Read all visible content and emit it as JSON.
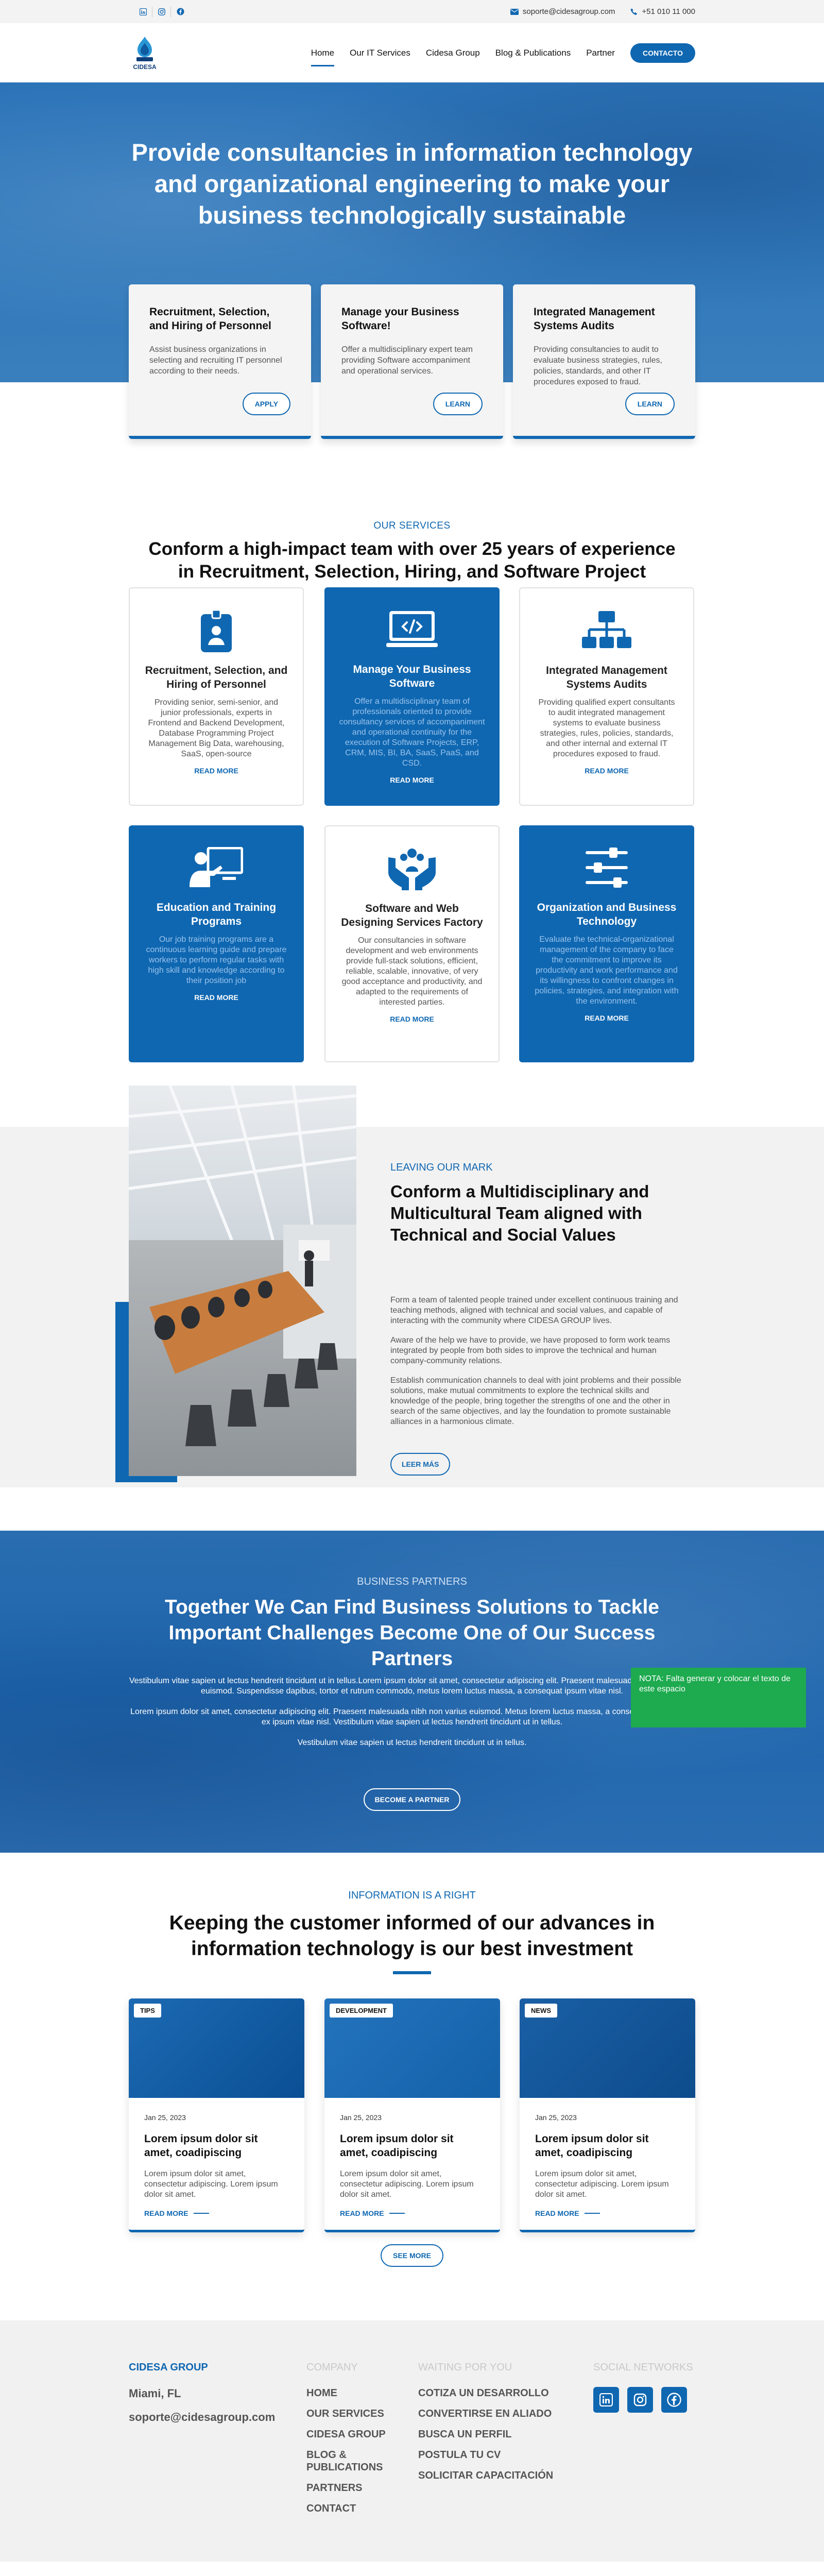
{
  "topbar": {
    "email": "soporte@cidesagroup.com",
    "phone": "+51 010 11 000"
  },
  "header": {
    "logo_text": "CIDESA",
    "nav": [
      "Home",
      "Our IT Services",
      "Cidesa Group",
      "Blog & Publications",
      "Partner"
    ],
    "contact_label": "CONTACTO"
  },
  "hero": {
    "title": "Provide consultancies in information technology and organizational engineering to make your business technologically sustainable",
    "cards": [
      {
        "title": "Recruitment, Selection, and Hiring of Personnel",
        "text": "Assist business organizations in selecting and recruiting IT personnel according to their needs.",
        "button": "APPLY"
      },
      {
        "title": "Manage your Business Software!",
        "text": "Offer a multidisciplinary expert team providing Software accompaniment and operational services.",
        "button": "LEARN"
      },
      {
        "title": "Integrated Management Systems Audits",
        "text": "Providing consultancies to audit to evaluate business strategies, rules, policies, standards, and other IT procedures exposed to fraud.",
        "button": "LEARN"
      }
    ]
  },
  "services": {
    "kicker": "OUR SERVICES",
    "title": "Conform a high-impact team with over 25 years of experience in Recruitment, Selection, Hiring, and Software Project Management",
    "cards": [
      {
        "icon": "id-badge-icon",
        "title": "Recruitment, Selection, and Hiring of Personnel",
        "text": "Providing senior, semi-senior, and junior professionals, experts in Frontend and Backend Development, Database Programming Project Management Big Data, warehousing, SaaS, open-source",
        "link": "READ MORE"
      },
      {
        "icon": "code-monitor-icon",
        "title": "Manage Your Business Software",
        "text": "Offer a multidisciplinary team of professionals oriented to provide consultancy services of accompaniment and operational continuity for the execution of Software Projects, ERP, CRM, MIS, BI, BA, SaaS, PaaS, and CSD.",
        "link": "READ MORE"
      },
      {
        "icon": "sitemap-icon",
        "title": "Integrated Management Systems Audits",
        "text": "Providing qualified expert consultants to audit integrated management systems to evaluate business strategies, rules, policies, standards, and other internal and external IT procedures exposed to fraud.",
        "link": "READ MORE"
      },
      {
        "icon": "teacher-icon",
        "title": "Education and Training Programs",
        "text": "Our job training programs are a continuous learning guide and prepare workers to perform regular tasks with high skill and knowledge according to their position job",
        "link": "READ MORE"
      },
      {
        "icon": "hands-people-icon",
        "title": "Software and Web Designing Services Factory",
        "text": "Our consultancies in software development and web environments provide full-stack solutions, efficient, reliable, scalable, innovative, of very good acceptance and productivity, and adapted to the requirements of interested parties.",
        "link": "READ MORE"
      },
      {
        "icon": "sliders-icon",
        "title": "Organization and Business Technology",
        "text": "Evaluate the technical-organizational management of the company to face the commitment to improve its productivity and work performance and its willingness to confront changes in policies, strategies, and integration with the environment.",
        "link": "READ MORE"
      }
    ]
  },
  "mark": {
    "kicker": "LEAVING OUR MARK",
    "title": "Conform a Multidisciplinary and Multicultural Team aligned with Technical and Social Values",
    "paragraphs": [
      "Form a team of talented people trained under excellent continuous training and teaching methods, aligned with technical and social values, and capable of interacting with the community where CIDESA GROUP lives.",
      "Aware of the help we have to provide, we have proposed to form work teams integrated by people from both sides to improve the technical and human company-community relations.",
      "Establish communication channels to deal with joint problems and their possible solutions, make mutual commitments to explore the technical skills and knowledge of the people, bring together the strengths of one and the other in search of the same objectives, and lay the foundation to promote sustainable alliances in a harmonious climate."
    ],
    "button": "LEER MÁS"
  },
  "partners": {
    "kicker": "BUSINESS PARTNERS",
    "title": "Together We Can Find Business Solutions to Tackle Important Challenges Become One of Our Success Partners",
    "paragraphs": [
      "Vestibulum vitae sapien ut lectus hendrerit tincidunt ut in tellus.Lorem ipsum dolor sit amet, consectetur adipiscing elit. Praesent malesuada nibh non varius euismod. Suspendisse dapibus, tortor et rutrum commodo, metus lorem luctus massa, a consequat ipsum vitae nisl.",
      "Lorem ipsum dolor sit amet, consectetur adipiscing elit. Praesent malesuada nibh non varius euismod. Metus lorem luctus massa, a consequat eu posuere ex ipsum vitae nisl. Vestibulum vitae sapien ut lectus hendrerit tincidunt ut in tellus.",
      "Vestibulum vitae sapien ut lectus hendrerit tincidunt ut in tellus."
    ],
    "button": "BECOME A PARTNER",
    "note": "NOTA: Falta generar y colocar el texto de este espacio"
  },
  "info": {
    "kicker": "INFORMATION IS A RIGHT",
    "title": "Keeping the customer informed of our advances in information technology is our best investment",
    "posts": [
      {
        "tag": "TIPS",
        "date": "Jan 25, 2023",
        "title": "Lorem ipsum dolor sit amet, coadipiscing",
        "text": "Lorem ipsum dolor sit amet, consectetur adipiscing. Lorem ipsum dolor sit amet.",
        "link": "READ MORE"
      },
      {
        "tag": "DEVELOPMENT",
        "date": "Jan 25, 2023",
        "title": "Lorem ipsum dolor sit amet, coadipiscing",
        "text": "Lorem ipsum dolor sit amet, consectetur adipiscing. Lorem ipsum dolor sit amet.",
        "link": "READ MORE"
      },
      {
        "tag": "NEWS",
        "date": "Jan 25, 2023",
        "title": "Lorem ipsum dolor sit amet, coadipiscing",
        "text": "Lorem ipsum dolor sit amet, consectetur adipiscing. Lorem ipsum dolor sit amet.",
        "link": "READ MORE"
      }
    ],
    "button": "SEE MORE"
  },
  "footer": {
    "brand": "CIDESA GROUP",
    "location": "Miami, FL",
    "email": "soporte@cidesagroup.com",
    "company_heading": "COMPANY",
    "company_links": [
      "HOME",
      "OUR SERVICES",
      "CIDESA GROUP",
      "BLOG & PUBLICATIONS",
      "PARTNERS",
      "CONTACT"
    ],
    "waiting_heading": "WAITING POR YOU",
    "waiting_links": [
      "COTIZA UN DESARROLLO",
      "CONVERTIRSE EN ALIADO",
      "BUSCA UN PERFIL",
      "POSTULA TU CV",
      "SOLICITAR CAPACITACIÓN"
    ],
    "social_heading": "SOCIAL NETWORKS",
    "social_icons": [
      "linkedin-icon",
      "instagram-icon",
      "facebook-icon"
    ]
  },
  "colors": {
    "accent": "#0f67b1",
    "note": "#1eaa4f",
    "light_bg": "#f2f2f2"
  }
}
